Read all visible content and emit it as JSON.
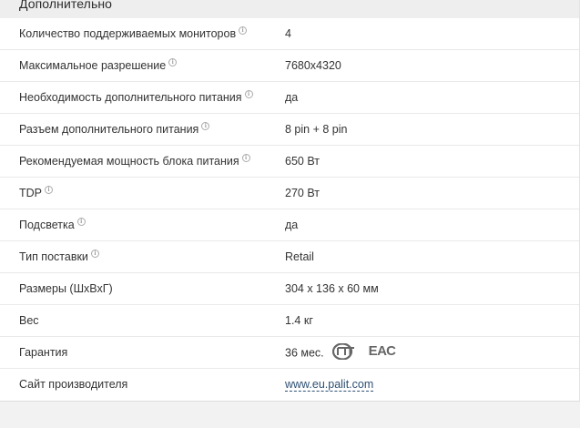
{
  "section": {
    "title": "Дополнительно"
  },
  "rows": [
    {
      "label": "Количество поддерживаемых мониторов",
      "value": "4",
      "info": "i"
    },
    {
      "label": "Максимальное разрешение",
      "value": "7680x4320",
      "info": "i"
    },
    {
      "label": "Необходимость дополнительного питания",
      "value": "да",
      "info": "i"
    },
    {
      "label": "Разъем дополнительного питания",
      "value": "8 pin + 8 pin",
      "info": "i"
    },
    {
      "label": "Рекомендуемая мощность блока питания",
      "value": "650 Вт",
      "info": "i"
    },
    {
      "label": "TDP",
      "value": "270 Вт",
      "info": "i"
    },
    {
      "label": "Подсветка",
      "value": "да",
      "info": "i"
    },
    {
      "label": "Тип поставки",
      "value": "Retail",
      "info": "i"
    },
    {
      "label": "Размеры (ШхВхГ)",
      "value": "304 x 136 x 60 мм"
    },
    {
      "label": "Вес",
      "value": "1.4 кг"
    },
    {
      "label": "Гарантия",
      "value": "36 мес.",
      "eac": "ЕАС"
    },
    {
      "label": "Сайт производителя",
      "value": "www.eu.palit.com"
    }
  ],
  "icons": {
    "info": "info-icon",
    "pct": "pct-certification-icon",
    "eac": "eac-certification-icon"
  },
  "colors": {
    "link": "#2e4f73",
    "header_bg": "#eeeeee",
    "page_bg": "#f2f2f2"
  }
}
